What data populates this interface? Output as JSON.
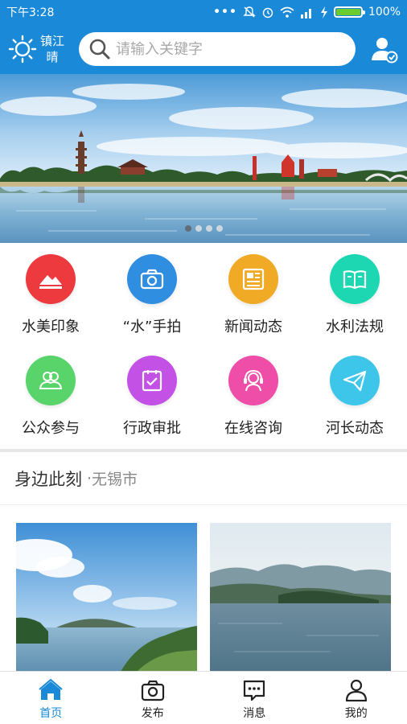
{
  "status_bar": {
    "time": "下午3:28",
    "dots": "•••",
    "battery": "100%",
    "battery_level": 1.0
  },
  "header": {
    "city": "镇江",
    "weather": "晴",
    "search_placeholder": "请输入关键字"
  },
  "banner": {
    "slide_count": 4,
    "active_index": 0
  },
  "menu": [
    {
      "label": "水美印象",
      "icon": "mountain-icon",
      "color": "#ec3a3f"
    },
    {
      "label": "“水”手拍",
      "icon": "camera-icon",
      "color": "#2f8ee0"
    },
    {
      "label": "新闻动态",
      "icon": "newspaper-icon",
      "color": "#f1aa25"
    },
    {
      "label": "水利法规",
      "icon": "book-icon",
      "color": "#1dd6b2"
    },
    {
      "label": "公众参与",
      "icon": "people-icon",
      "color": "#58d46a"
    },
    {
      "label": "行政审批",
      "icon": "clipboard-check-icon",
      "color": "#c451e6"
    },
    {
      "label": "在线咨询",
      "icon": "headset-icon",
      "color": "#ee4ea8"
    },
    {
      "label": "河长动态",
      "icon": "paper-plane-icon",
      "color": "#3ec6ea"
    }
  ],
  "section": {
    "title": "身边此刻",
    "separator": "·",
    "city": "无锡市"
  },
  "bottom_nav": [
    {
      "label": "首页",
      "icon": "home-icon",
      "active": true
    },
    {
      "label": "发布",
      "icon": "camera-icon",
      "active": false
    },
    {
      "label": "消息",
      "icon": "message-icon",
      "active": false
    },
    {
      "label": "我的",
      "icon": "person-icon",
      "active": false
    }
  ],
  "colors": {
    "primary": "#1a8ad8",
    "battery": "#6ccc2f"
  }
}
